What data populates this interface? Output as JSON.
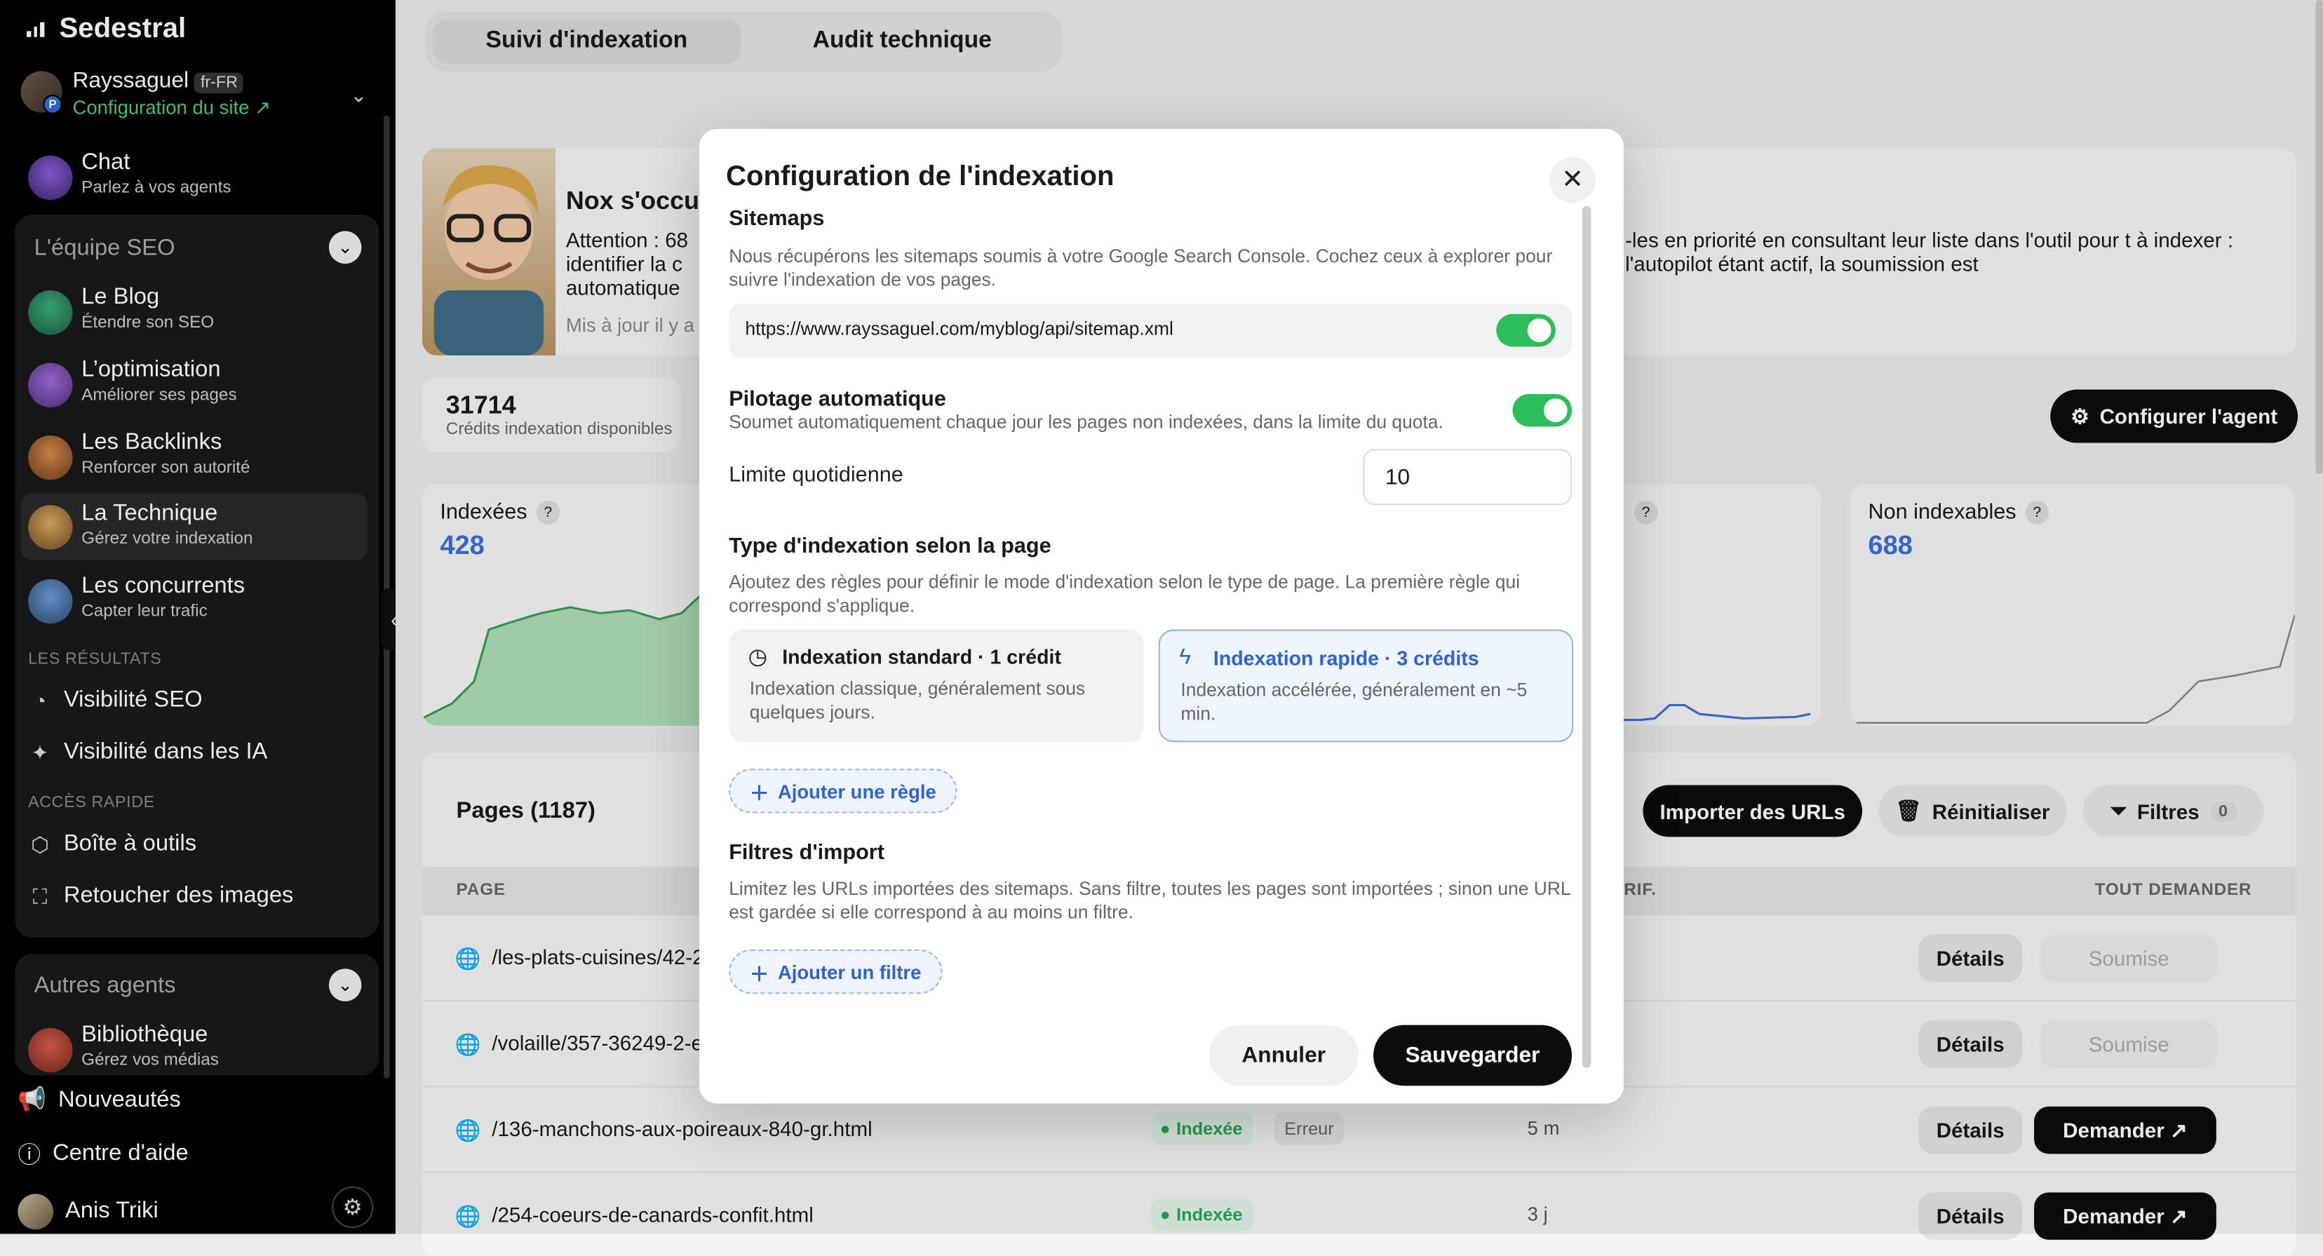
{
  "app": {
    "brand": "Sedestral",
    "site_name": "Rayssaguel",
    "site_lang": "fr-FR",
    "site_config": "Configuration du site ↗"
  },
  "sidebar": {
    "chat": {
      "title": "Chat",
      "subtitle": "Parlez à vos agents"
    },
    "seo_team": {
      "title": "L'équipe SEO",
      "items": [
        {
          "title": "Le Blog",
          "subtitle": "Étendre son SEO"
        },
        {
          "title": "L’optimisation",
          "subtitle": "Améliorer ses pages"
        },
        {
          "title": "Les Backlinks",
          "subtitle": "Renforcer son autorité"
        },
        {
          "title": "La Technique",
          "subtitle": "Gérez votre indexation"
        },
        {
          "title": "Les concurrents",
          "subtitle": "Capter leur trafic"
        }
      ],
      "results_label": "LES RÉSULTATS",
      "results": [
        "Visibilité SEO",
        "Visibilité dans les IA"
      ],
      "quick_label": "ACCÈS RAPIDE",
      "quick": [
        "Boîte à outils",
        "Retoucher des images"
      ]
    },
    "other_agents": {
      "title": "Autres agents",
      "items": [
        {
          "title": "Bibliothèque",
          "subtitle": "Gérez vos médias"
        }
      ]
    },
    "bottom": {
      "news": "Nouveautés",
      "help": "Centre d'aide",
      "user": "Anis Triki"
    }
  },
  "main": {
    "tabs": [
      "Suivi d'indexation",
      "Audit technique"
    ],
    "agent": {
      "title": "Nox s'occu",
      "text_left": "Attention : 68 identifier la c automatique",
      "text_right": "-les en priorité en consultant leur liste dans l'outil pour t à indexer : l'autopilot étant actif, la soumission est",
      "updated": "Mis à jour il y a"
    },
    "credits": {
      "value": "31714",
      "label": "Crédits indexation disponibles"
    },
    "configure_agent": "Configurer l'agent",
    "stats": [
      {
        "label": "Indexées",
        "value": "428",
        "help": "?"
      },
      {
        "label": "",
        "value": "",
        "help": "?"
      },
      {
        "label": "Non indexables",
        "value": "688",
        "help": "?"
      }
    ],
    "table": {
      "title": "Pages (1187)",
      "import_button": "Importer des URLs",
      "reset_button": "Réinitialiser",
      "filters_button": "Filtres",
      "filters_count": "0",
      "headers": {
        "page": "PAGE",
        "verif": "VÉRIF.",
        "request_all": "TOUT DEMANDER"
      },
      "rows": [
        {
          "path": "/les-plats-cuisines/42-2",
          "status": "",
          "error": "",
          "ago": "",
          "details": "Détails",
          "action": "Soumise",
          "action_state": "submitted"
        },
        {
          "path": "/volaille/357-36249-2-e",
          "status": "",
          "error": "",
          "ago": "",
          "details": "Détails",
          "action": "Soumise",
          "action_state": "submitted"
        },
        {
          "path": "/136-manchons-aux-poireaux-840-gr.html",
          "status": "Indexée",
          "error": "Erreur",
          "ago": "5 m",
          "details": "Détails",
          "action": "Demander ↗",
          "action_state": "request"
        },
        {
          "path": "/254-coeurs-de-canards-confit.html",
          "status": "Indexée",
          "error": "",
          "ago": "3 j",
          "details": "Détails",
          "action": "Demander ↗",
          "action_state": "request"
        }
      ]
    }
  },
  "modal": {
    "title": "Configuration de l'indexation",
    "sitemaps": {
      "title": "Sitemaps",
      "desc": "Nous récupérons les sitemaps soumis à votre Google Search Console. Cochez ceux à explorer pour suivre l'indexation de vos pages.",
      "url": "https://www.rayssaguel.com/myblog/api/sitemap.xml",
      "enabled": true
    },
    "autopilot": {
      "title": "Pilotage automatique",
      "desc": "Soumet automatiquement chaque jour les pages non indexées, dans la limite du quota.",
      "enabled": true
    },
    "daily_limit": {
      "label": "Limite quotidienne",
      "value": "10"
    },
    "type_rules": {
      "title": "Type d'indexation selon la page",
      "desc": "Ajoutez des règles pour définir le mode d'indexation selon le type de page. La première règle qui correspond s'applique.",
      "standard": {
        "title": "Indexation standard · 1 crédit",
        "desc": "Indexation classique, généralement sous quelques jours.",
        "icon": "clock-icon"
      },
      "fast": {
        "title": "Indexation rapide · 3 crédits",
        "desc": "Indexation accélérée, généralement en ~5 min.",
        "icon": "bolt-icon",
        "selected": true
      },
      "add_rule": "Ajouter une règle"
    },
    "import_filters": {
      "title": "Filtres d'import",
      "desc": "Limitez les URLs importées des sitemaps. Sans filtre, toutes les pages sont importées ; sinon une URL est gardée si elle correspond à au moins un filtre.",
      "add_filter": "Ajouter un filtre"
    },
    "cancel": "Annuler",
    "save": "Sauvegarder"
  },
  "colors": {
    "accent_blue": "#2f63d0",
    "toggle_green": "#2ebd5b",
    "dark": "#0d0d0d"
  }
}
